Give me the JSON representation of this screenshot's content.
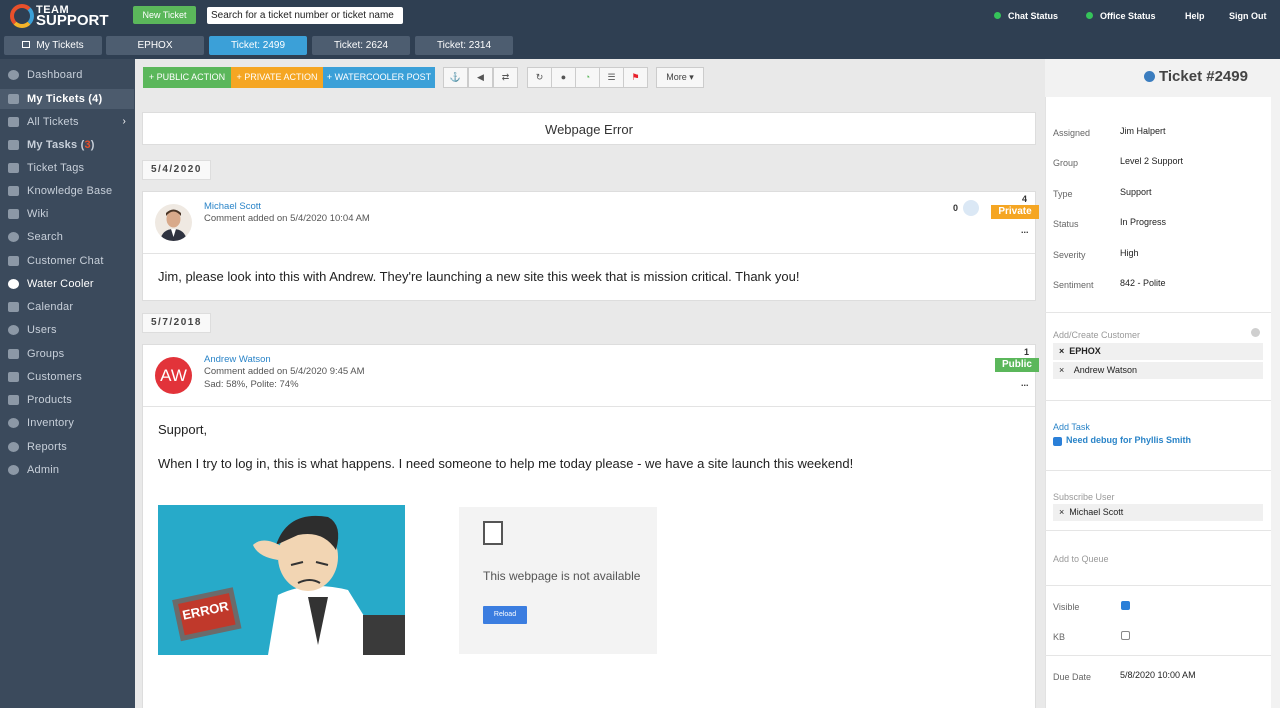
{
  "topbar": {
    "logo_line1": "TEAM",
    "logo_line2": "SUPPORT",
    "new_ticket_label": "New Ticket",
    "search_placeholder": "Search for a ticket number or ticket name",
    "chat_status": "Chat Status",
    "office_status": "Office Status",
    "help": "Help",
    "sign_out": "Sign Out"
  },
  "tabs": [
    "My Tickets",
    "EPHOX",
    "Ticket: 2499",
    "Ticket: 2624",
    "Ticket: 2314"
  ],
  "sidebar": {
    "items": [
      {
        "label": "Dashboard"
      },
      {
        "label": "My Tickets (4)"
      },
      {
        "label": "All Tickets"
      },
      {
        "label_pre": "My Tasks (",
        "count": "3",
        "label_post": ")"
      },
      {
        "label": "Ticket Tags"
      },
      {
        "label": "Knowledge Base"
      },
      {
        "label": "Wiki"
      },
      {
        "label": "Search"
      },
      {
        "label": "Customer Chat"
      },
      {
        "label": "Water Cooler"
      },
      {
        "label": "Calendar"
      },
      {
        "label": "Users"
      },
      {
        "label": "Groups"
      },
      {
        "label": "Customers"
      },
      {
        "label": "Products"
      },
      {
        "label": "Inventory"
      },
      {
        "label": "Reports"
      },
      {
        "label": "Admin"
      }
    ]
  },
  "toolbar": {
    "public_action": "+ PUBLIC ACTION",
    "private_action": "+ PRIVATE ACTION",
    "watercooler_post": "+ WATERCOOLER POST",
    "more": "More ▾"
  },
  "ticket": {
    "subject": "Webpage Error",
    "number_title": "Ticket #2499"
  },
  "posts": [
    {
      "date": "5/4/2020",
      "author": "Michael Scott",
      "meta": "Comment added on 5/4/2020 10:04 AM",
      "likes": "0",
      "count": "4",
      "visibility": "Private",
      "more": "...",
      "body": "Jim, please look into this with Andrew.  They're launching a new site this week that is mission critical. Thank you!"
    },
    {
      "date": "5/7/2018",
      "author": "Andrew Watson",
      "avatar_initials": "AW",
      "meta": "Comment added on 5/4/2020 9:45 AM",
      "sentiment": "Sad: 58%, Polite: 74%",
      "count": "1",
      "visibility": "Public",
      "more": "...",
      "body_greeting": "Support,",
      "body": "When I try to log in, this is what happens.  I need someone to help me today please - we have a site launch this weekend!",
      "image_error_text": "ERROR",
      "screenshot_text": "This webpage is not available",
      "screenshot_button": "Reload"
    }
  ],
  "properties": {
    "assigned": {
      "label": "Assigned",
      "value": "Jim Halpert"
    },
    "group": {
      "label": "Group",
      "value": "Level 2 Support"
    },
    "type": {
      "label": "Type",
      "value": "Support"
    },
    "status": {
      "label": "Status",
      "value": "In Progress"
    },
    "severity": {
      "label": "Severity",
      "value": "High"
    },
    "sentiment": {
      "label": "Sentiment",
      "value": "842 - Polite"
    },
    "add_customer_label": "Add/Create Customer",
    "customers": [
      "EPHOX",
      "Andrew Watson"
    ],
    "add_task": "Add Task",
    "task": "Need debug for Phyllis Smith",
    "subscribe_label": "Subscribe User",
    "subscribers": [
      "Michael Scott"
    ],
    "add_to_queue": "Add to Queue",
    "visible_label": "Visible",
    "visible_checked": true,
    "kb_label": "KB",
    "kb_checked": false,
    "due_date_label": "Due Date",
    "due_date": "5/8/2020 10:00 AM",
    "remove_glyph": "×"
  },
  "colors": {
    "topbar": "#2f3f52",
    "sidebar": "#3b4a5c",
    "public_green": "#5bb75b",
    "private_orange": "#f5a623",
    "watercooler_blue": "#3ba0d8",
    "link_blue": "#2a84c8"
  }
}
